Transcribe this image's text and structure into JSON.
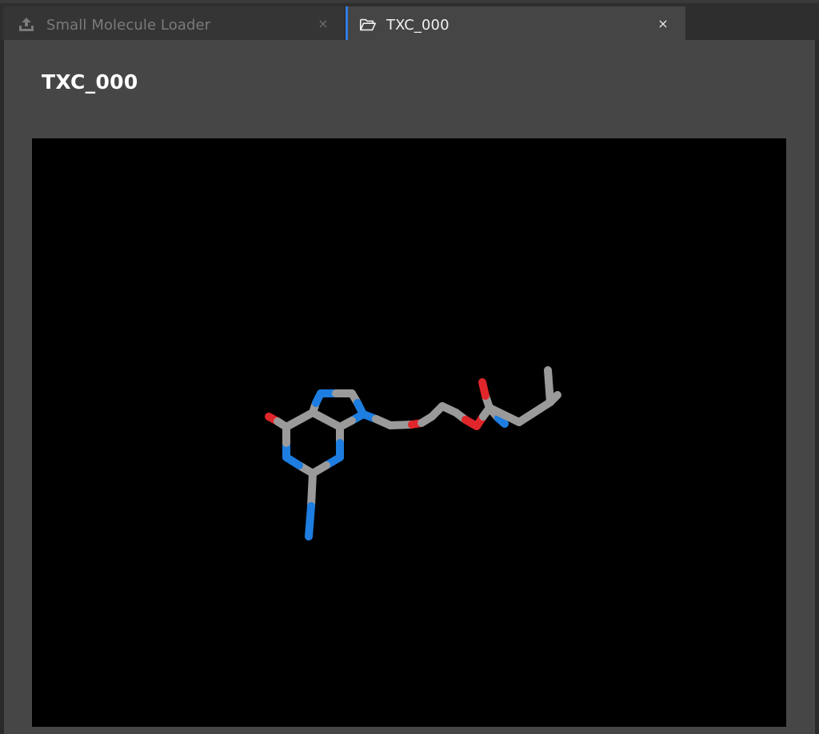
{
  "tabs": [
    {
      "label": "Small Molecule Loader",
      "icon": "upload-icon",
      "active": false
    },
    {
      "label": "TXC_000",
      "icon": "folder-open-icon",
      "active": true
    }
  ],
  "close_glyph": "×",
  "panel": {
    "title": "TXC_000"
  },
  "viewer": {
    "background": "#000000",
    "style": "sticks",
    "colors": {
      "carbon": "#9a9a9a",
      "nitrogen": "#1d7de0",
      "oxygen": "#e0262b"
    }
  },
  "colors": {
    "accent": "#2f7de1",
    "panel_bg": "#464646",
    "tab_active_bg": "#454545",
    "tab_inactive_bg": "#353535"
  }
}
